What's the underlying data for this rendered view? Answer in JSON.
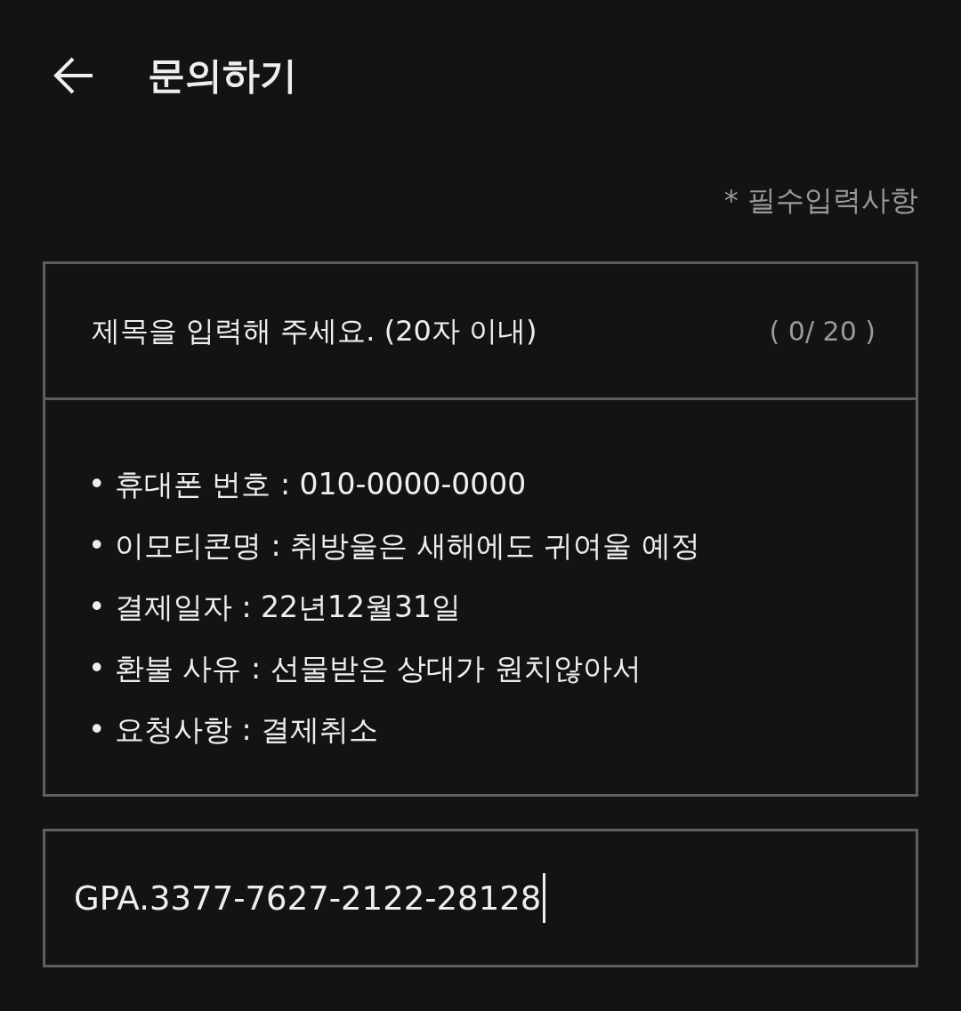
{
  "header": {
    "title": "문의하기"
  },
  "required_note": "* 필수입력사항",
  "title_field": {
    "placeholder": "제목을 입력해 주세요. (20자 이내)",
    "counter": "( 0/ 20 )"
  },
  "body_field": {
    "lines": [
      "• 휴대폰 번호 : 010-0000-0000",
      "• 이모티콘명 : 취방울은 새해에도 귀여울 예정",
      "• 결제일자 : 22년12월31일",
      "• 환불 사유 : 선물받은 상대가 원치않아서",
      "• 요청사항 :  결제취소"
    ]
  },
  "order_field": {
    "value": "GPA.3377-7627-2122-28128",
    "focused": true
  }
}
